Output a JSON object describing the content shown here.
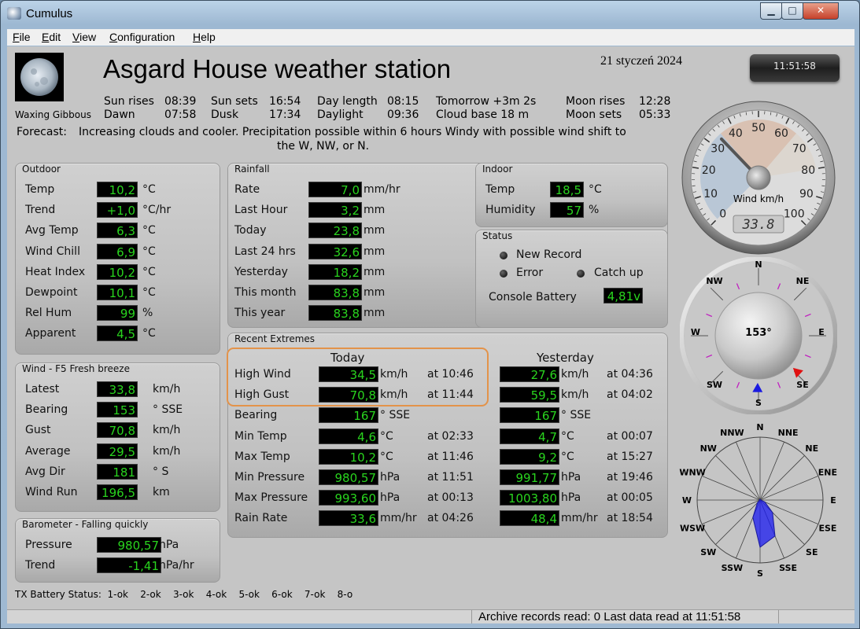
{
  "window": {
    "title": "Cumulus",
    "controls": {
      "minimize": "▁",
      "maximize": "□",
      "close": "✕"
    }
  },
  "menu": [
    "File",
    "Edit",
    "View",
    "Configuration",
    "Help"
  ],
  "header": {
    "station_title": "Asgard House weather station",
    "date": "21 styczeń 2024",
    "clock": "11:51:58",
    "moon_phase": "Waxing Gibbous",
    "sun": {
      "sun_rises_label": "Sun rises",
      "sun_rises": "08:39",
      "dawn_label": "Dawn",
      "dawn": "07:58",
      "sun_sets_label": "Sun sets",
      "sun_sets": "16:54",
      "dusk_label": "Dusk",
      "dusk": "17:34",
      "day_length_label": "Day length",
      "day_length": "08:15",
      "daylight_label": "Daylight",
      "daylight": "09:36",
      "tomorrow": "Tomorrow +3m 2s",
      "cloud_base": "Cloud base 18 m",
      "moon_rises_label": "Moon rises",
      "moon_rises": "12:28",
      "moon_sets_label": "Moon sets",
      "moon_sets": "05:33"
    },
    "forecast_label": "Forecast:",
    "forecast_line1": "Increasing clouds and cooler. Precipitation possible within 6 hours Windy with possible wind shift to",
    "forecast_line2": "the W, NW, or N."
  },
  "outdoor": {
    "title": "Outdoor",
    "rows": [
      {
        "label": "Temp",
        "value": "10,2",
        "unit": "°C"
      },
      {
        "label": "Trend",
        "value": "+1,0",
        "unit": "°C/hr"
      },
      {
        "label": "Avg Temp",
        "value": "6,3",
        "unit": "°C"
      },
      {
        "label": "Wind Chill",
        "value": "6,9",
        "unit": "°C"
      },
      {
        "label": "Heat Index",
        "value": "10,2",
        "unit": "°C"
      },
      {
        "label": "Dewpoint",
        "value": "10,1",
        "unit": "°C"
      },
      {
        "label": "Rel Hum",
        "value": "99",
        "unit": "%"
      },
      {
        "label": "Apparent",
        "value": "4,5",
        "unit": "°C"
      }
    ]
  },
  "wind": {
    "title": "Wind - F5 Fresh breeze",
    "rows": [
      {
        "label": "Latest",
        "value": "33,8",
        "unit": "km/h"
      },
      {
        "label": "Bearing",
        "value": "153",
        "unit": "° SSE"
      },
      {
        "label": "Gust",
        "value": "70,8",
        "unit": "km/h"
      },
      {
        "label": "Average",
        "value": "29,5",
        "unit": "km/h"
      },
      {
        "label": "Avg Dir",
        "value": "181",
        "unit": "° S"
      },
      {
        "label": "Wind Run",
        "value": "196,5",
        "unit": "km"
      }
    ]
  },
  "barometer": {
    "title": "Barometer - Falling quickly",
    "rows": [
      {
        "label": "Pressure",
        "value": "980,57",
        "unit": "hPa"
      },
      {
        "label": "Trend",
        "value": "-1,41",
        "unit": "hPa/hr"
      }
    ]
  },
  "rainfall": {
    "title": "Rainfall",
    "rows": [
      {
        "label": "Rate",
        "value": "7,0",
        "unit": "mm/hr"
      },
      {
        "label": "Last Hour",
        "value": "3,2",
        "unit": "mm"
      },
      {
        "label": "Today",
        "value": "23,8",
        "unit": "mm"
      },
      {
        "label": "Last 24 hrs",
        "value": "32,6",
        "unit": "mm"
      },
      {
        "label": "Yesterday",
        "value": "18,2",
        "unit": "mm"
      },
      {
        "label": "This month",
        "value": "83,8",
        "unit": "mm"
      },
      {
        "label": "This year",
        "value": "83,8",
        "unit": "mm"
      }
    ]
  },
  "indoor": {
    "title": "Indoor",
    "rows": [
      {
        "label": "Temp",
        "value": "18,5",
        "unit": "°C"
      },
      {
        "label": "Humidity",
        "value": "57",
        "unit": "%"
      }
    ]
  },
  "status": {
    "title": "Status",
    "new_record": "New Record",
    "error": "Error",
    "catch_up": "Catch up",
    "console_battery_label": "Console Battery",
    "console_battery": "4,81v"
  },
  "extremes": {
    "title": "Recent Extremes",
    "today_header": "Today",
    "yesterday_header": "Yesterday",
    "rows": [
      {
        "label": "High Wind",
        "today": "34,5",
        "today_unit": "km/h",
        "today_at": "at 10:46",
        "yest": "27,6",
        "yest_unit": "km/h",
        "yest_at": "at 04:36"
      },
      {
        "label": "High Gust",
        "today": "70,8",
        "today_unit": "km/h",
        "today_at": "at 11:44",
        "yest": "59,5",
        "yest_unit": "km/h",
        "yest_at": "at 04:02"
      },
      {
        "label": "Bearing",
        "today": "167",
        "today_unit": "°  SSE",
        "today_at": "",
        "yest": "167",
        "yest_unit": "°  SSE",
        "yest_at": ""
      },
      {
        "label": "Min Temp",
        "today": "4,6",
        "today_unit": "°C",
        "today_at": "at 02:33",
        "yest": "4,7",
        "yest_unit": "°C",
        "yest_at": "at 00:07"
      },
      {
        "label": "Max Temp",
        "today": "10,2",
        "today_unit": "°C",
        "today_at": "at 11:46",
        "yest": "9,2",
        "yest_unit": "°C",
        "yest_at": "at 15:27"
      },
      {
        "label": "Min Pressure",
        "today": "980,57",
        "today_unit": "hPa",
        "today_at": "at 11:51",
        "yest": "991,77",
        "yest_unit": "hPa",
        "yest_at": "at 19:46"
      },
      {
        "label": "Max Pressure",
        "today": "993,60",
        "today_unit": "hPa",
        "today_at": "at 00:13",
        "yest": "1003,80",
        "yest_unit": "hPa",
        "yest_at": "at 00:05"
      },
      {
        "label": "Rain Rate",
        "today": "33,6",
        "today_unit": "mm/hr",
        "today_at": "at 04:26",
        "yest": "48,4",
        "yest_unit": "mm/hr",
        "yest_at": "at 18:54"
      }
    ]
  },
  "wind_gauge": {
    "scale_labels": [
      "0",
      "10",
      "20",
      "30",
      "40",
      "50",
      "60",
      "70",
      "80",
      "90",
      "100"
    ],
    "caption": "Wind km/h",
    "readout": "33.8",
    "needle_value": 33.8,
    "max": 100
  },
  "compass": {
    "labels": {
      "n": "N",
      "ne": "NE",
      "e": "E",
      "se": "SE",
      "s": "S",
      "sw": "SW",
      "w": "W",
      "nw": "NW"
    },
    "bearing_text": "153°",
    "bearing": 153
  },
  "wind_rose": {
    "labels": [
      "N",
      "NNE",
      "NE",
      "ENE",
      "E",
      "ESE",
      "SE",
      "SSE",
      "S",
      "SSW",
      "SW",
      "WSW",
      "W",
      "WNW",
      "NW",
      "NNW"
    ],
    "shape": [
      0.01,
      0.01,
      0.01,
      0.01,
      0.01,
      0.08,
      0.28,
      0.62,
      0.75,
      0.3,
      0.06,
      0.01,
      0.01,
      0.01,
      0.01,
      0.01
    ],
    "fill_color": "#1a1af0"
  },
  "tx_battery": "TX Battery Status:  1-ok    2-ok    3-ok    4-ok    5-ok    6-ok    7-ok    8-o",
  "statusbar": {
    "text": "Archive records read: 0  Last data read at 11:51:58"
  },
  "colors": {
    "lcd_text": "#29d41e",
    "highlight": "#e3934a"
  }
}
